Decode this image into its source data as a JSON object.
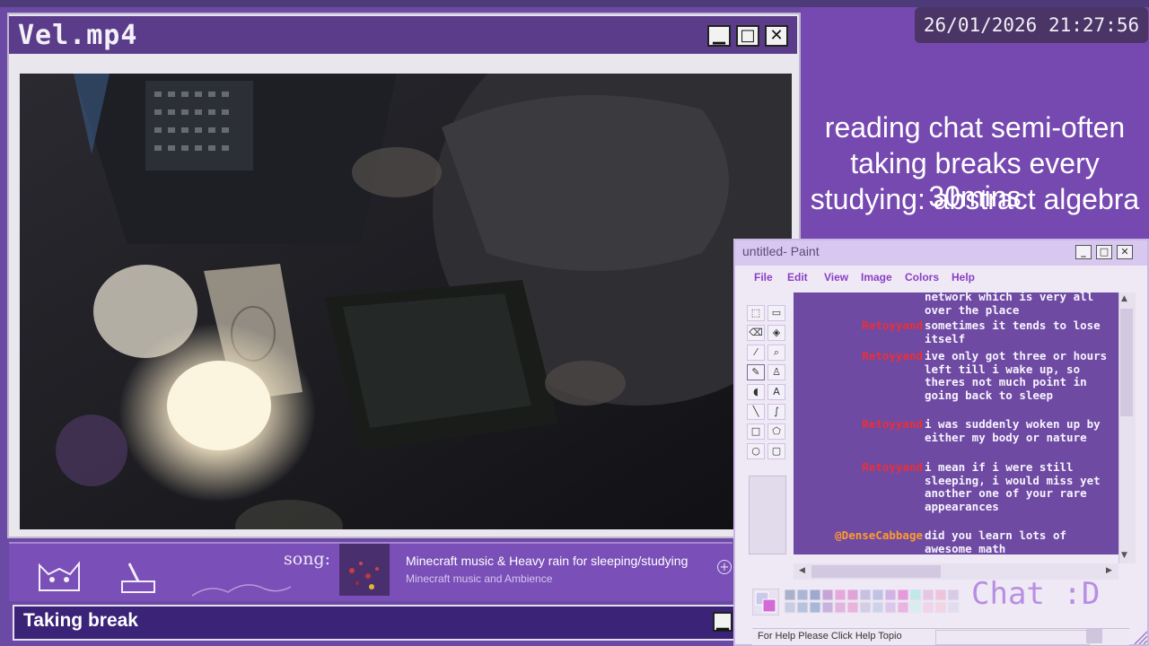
{
  "video_window": {
    "title": "Vel.mp4",
    "minimize": "▁",
    "maximize": "□",
    "close": "✕"
  },
  "clock": "26/01/2026 21:27:56",
  "status_lines": [
    "reading chat semi-often",
    "taking breaks every 30mins",
    "studying: abstract algebra"
  ],
  "song": {
    "label": "song:",
    "title": "Minecraft music & Heavy rain for sleeping/studying",
    "artist": "Minecraft music and Ambience",
    "plus": "+"
  },
  "break_bar": {
    "text": "Taking break"
  },
  "paint": {
    "title": "untitled- Paint",
    "menu": [
      "File",
      "Edit",
      "View",
      "Image",
      "Colors",
      "Help"
    ],
    "status": "For Help Please Click Help Topio",
    "chat_label": "Chat :D",
    "chat": [
      {
        "user": "",
        "message": "network which is very all over the place"
      },
      {
        "user": "Retoyyand",
        "message": "sometimes it tends to lose itself"
      },
      {
        "user": "Retoyyand",
        "message": "ive only got three or hours left till i wake up, so theres not much point in going back to sleep"
      },
      {
        "user": "Retoyyand",
        "message": "i was suddenly woken up by either my body or nature"
      },
      {
        "user": "Retoyyand",
        "message": "i mean if i were still sleeping, i would miss yet another one of your rare appearances"
      },
      {
        "user": "@DenseCabbage",
        "message": "did you learn lots of awesome math"
      }
    ]
  },
  "colors": {
    "accent": "#7649b0",
    "chat_user": "#e8303a",
    "mention_user": "#ff9a2e"
  }
}
